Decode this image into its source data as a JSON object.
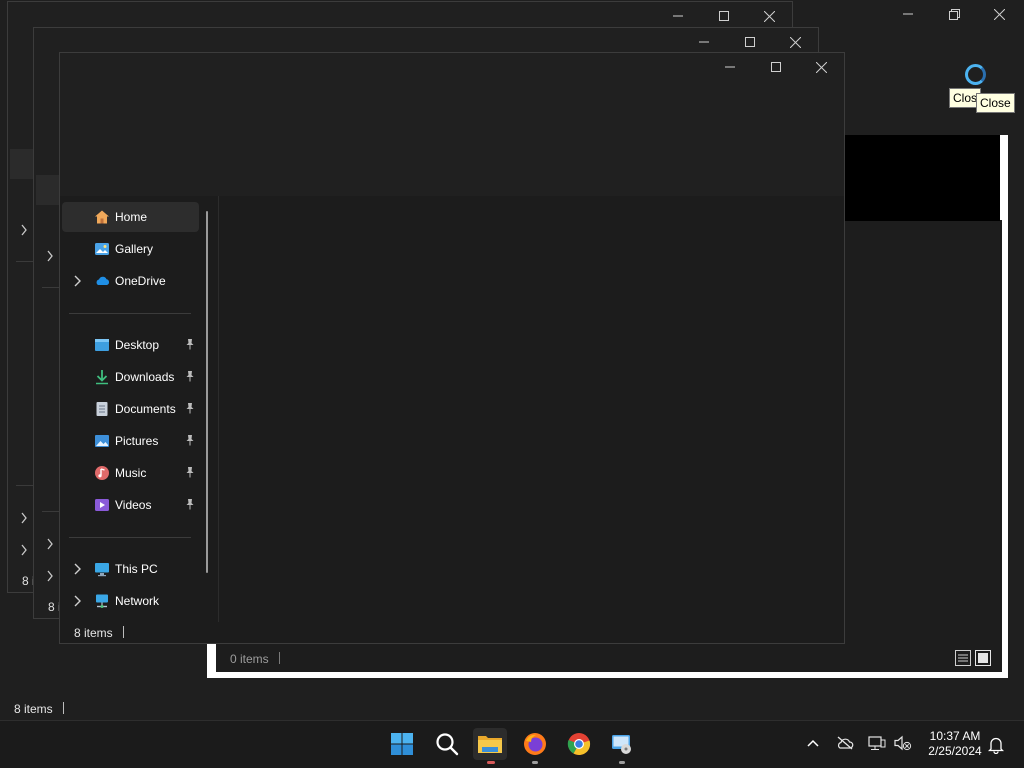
{
  "background_window": {
    "status_text": "8 items",
    "tooltips": [
      "Clos",
      "Close"
    ]
  },
  "white_window": {
    "status_text": "0 items"
  },
  "stacked_windows": {
    "status_fragments": [
      "8 i",
      "8 i"
    ]
  },
  "front_window": {
    "status_text": "8 items",
    "nav": [
      {
        "label": "Home",
        "icon": "home-icon",
        "selected": true
      },
      {
        "label": "Gallery",
        "icon": "gallery-icon"
      },
      {
        "label": "OneDrive",
        "icon": "onedrive-icon",
        "expandable": true
      },
      {
        "label": "Desktop",
        "icon": "desktop-folder-icon",
        "pinned": true
      },
      {
        "label": "Downloads",
        "icon": "downloads-icon",
        "pinned": true
      },
      {
        "label": "Documents",
        "icon": "documents-icon",
        "pinned": true
      },
      {
        "label": "Pictures",
        "icon": "pictures-icon",
        "pinned": true
      },
      {
        "label": "Music",
        "icon": "music-icon",
        "pinned": true
      },
      {
        "label": "Videos",
        "icon": "videos-icon",
        "pinned": true
      },
      {
        "label": "This PC",
        "icon": "this-pc-icon",
        "expandable": true
      },
      {
        "label": "Network",
        "icon": "network-icon",
        "expandable": true
      }
    ]
  },
  "taskbar": {
    "apps": [
      "start-icon",
      "search-icon",
      "file-explorer-icon",
      "firefox-icon",
      "chrome-icon",
      "disk-utility-icon"
    ],
    "active_app": "file-explorer-icon",
    "tray": [
      "chevron-up-icon",
      "onedrive-offline-icon",
      "network-icon",
      "volume-muted-icon"
    ],
    "clock": {
      "time": "10:37 AM",
      "date": "2/25/2024"
    }
  },
  "colors": {
    "accent": "#4cb3f0",
    "window_bg": "#1c1c1c",
    "tooltip_bg": "#ffffe1"
  }
}
